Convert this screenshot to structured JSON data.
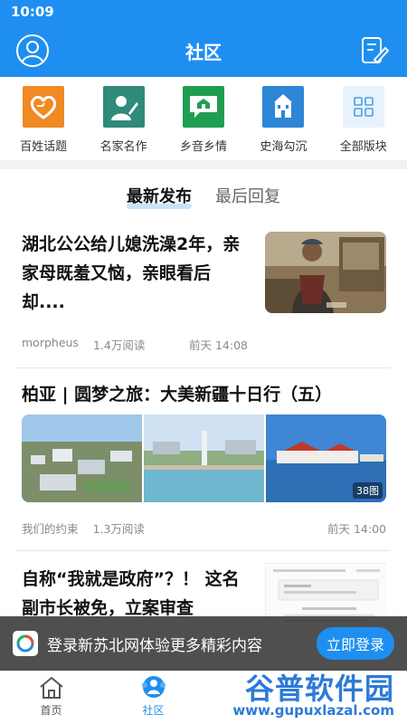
{
  "status": {
    "time": "10:09"
  },
  "header": {
    "title": "社区"
  },
  "categories": [
    {
      "label": "百姓话题",
      "color": "#f08a22"
    },
    {
      "label": "名家名作",
      "color": "#2f8a7a"
    },
    {
      "label": "乡音乡情",
      "color": "#1f9e52"
    },
    {
      "label": "史海勾沉",
      "color": "#2e86d6"
    },
    {
      "label": "全部版块",
      "color": "#e8f2fb"
    }
  ],
  "tabs": [
    {
      "label": "最新发布",
      "active": true
    },
    {
      "label": "最后回复",
      "active": false
    }
  ],
  "posts": [
    {
      "title": "湖北公公给儿媳洗澡2年，亲家母既羞又恼，亲眼看后却....",
      "author": "morpheus",
      "reads": "1.4万阅读",
      "time": "前天 14:08"
    },
    {
      "title": "柏亚 | 圆梦之旅：大美新疆十日行（五）",
      "author": "我们的约束",
      "reads": "1.3万阅读",
      "time": "前天 14:00",
      "image_count": "38图"
    },
    {
      "title": "自称“我就是政府”？！ 这名副市长被免，立案审查"
    }
  ],
  "banner": {
    "text": "登录新苏北网体验更多精彩内容",
    "button": "立即登录"
  },
  "nav": [
    {
      "label": "首页",
      "active": false
    },
    {
      "label": "社区",
      "active": true
    }
  ],
  "watermark": {
    "text": "谷普软件园",
    "url": "www.gupuxlazal.com"
  },
  "colors": {
    "brand": "#1e8ff0",
    "banner_bg": "#282828"
  }
}
